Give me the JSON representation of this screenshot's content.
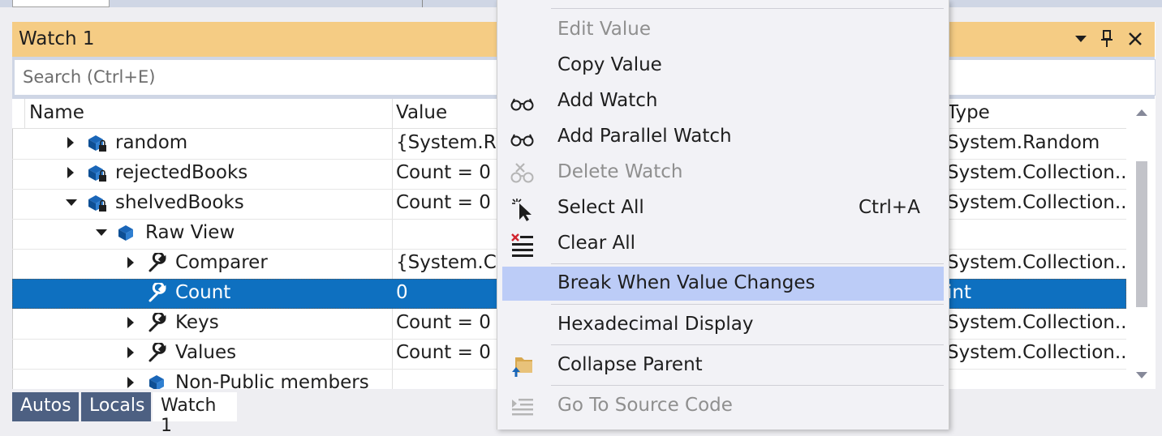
{
  "window": {
    "title": "Watch 1"
  },
  "search": {
    "placeholder": "Search (Ctrl+E)"
  },
  "columns": {
    "name": "Name",
    "value": "Value",
    "type": "Type"
  },
  "rows": [
    {
      "name": "random",
      "value": "{System.Ra",
      "type": "System.Random"
    },
    {
      "name": "rejectedBooks",
      "value": "Count = 0",
      "type": "System.Collection..."
    },
    {
      "name": "shelvedBooks",
      "value": "Count = 0",
      "type": "System.Collection..."
    },
    {
      "name": "Raw View",
      "value": "",
      "type": ""
    },
    {
      "name": "Comparer",
      "value": "{System.Co",
      "type": "System.Collection..."
    },
    {
      "name": "Count",
      "value": "0",
      "type": "int"
    },
    {
      "name": "Keys",
      "value": "Count = 0",
      "type": "System.Collection..."
    },
    {
      "name": "Values",
      "value": "Count = 0",
      "type": "System.Collection..."
    },
    {
      "name": "Non-Public members",
      "value": "",
      "type": ""
    }
  ],
  "tabs": [
    "Autos",
    "Locals",
    "Watch 1"
  ],
  "menu": {
    "items": [
      {
        "label": "Edit Value",
        "disabled": true
      },
      {
        "label": "Copy Value"
      },
      {
        "label": "Add Watch",
        "icon": "glasses-icon"
      },
      {
        "label": "Add Parallel Watch",
        "icon": "glasses-icon"
      },
      {
        "label": "Delete Watch",
        "icon": "delete-watch-icon",
        "disabled": true
      },
      {
        "label": "Select All",
        "icon": "cursor-icon",
        "shortcut": "Ctrl+A"
      },
      {
        "label": "Clear All",
        "icon": "clear-all-icon"
      },
      {
        "label": "Break When Value Changes",
        "highlighted": true
      },
      {
        "label": "Hexadecimal Display"
      },
      {
        "label": "Collapse Parent",
        "icon": "collapse-parent-icon"
      },
      {
        "label": "Go To Source Code",
        "icon": "goto-source-icon",
        "disabled": true
      }
    ]
  },
  "colors": {
    "title_bar": "#f5cc84",
    "selection": "#0e70c0",
    "menu_highlight": "#bcccf7",
    "tab_inactive": "#4d6082"
  }
}
